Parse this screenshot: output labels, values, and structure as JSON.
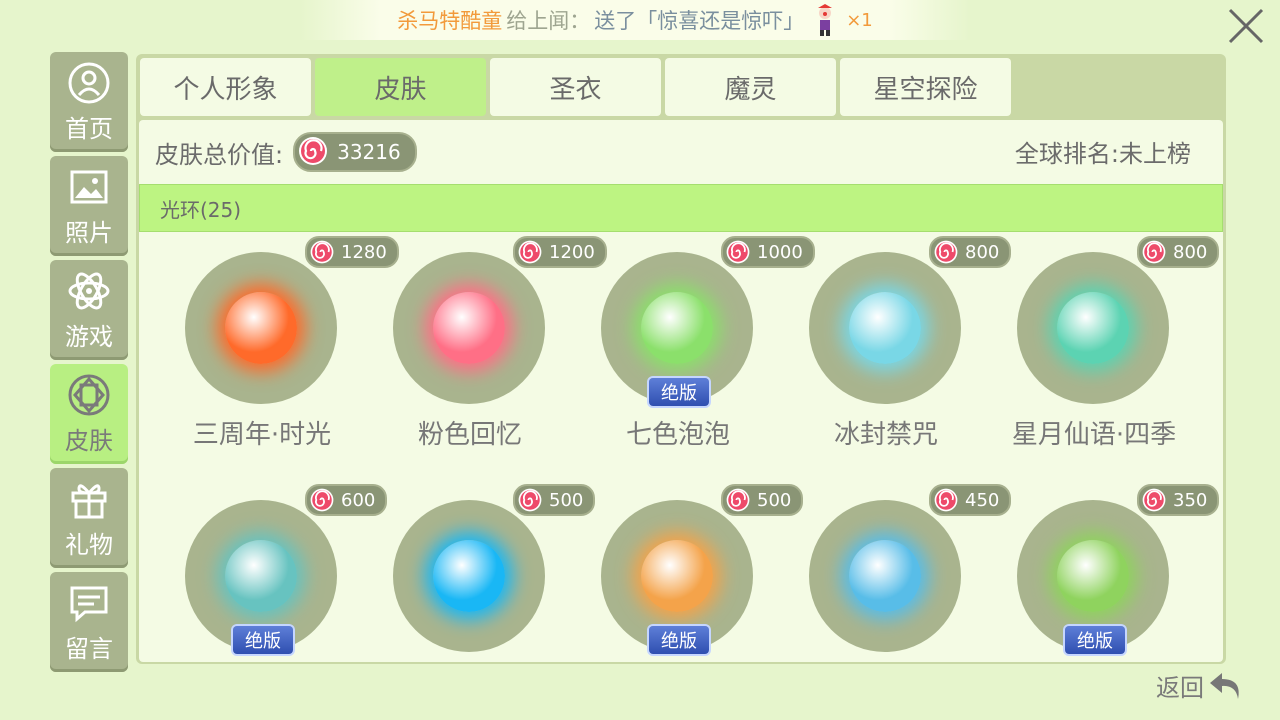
{
  "banner": {
    "sender": "杀马特酷童",
    "verb": "给上闻：",
    "gift_text": "送了「惊喜还是惊吓」",
    "count": "×1"
  },
  "sidebar": {
    "items": [
      {
        "label": "首页",
        "icon": "user-circle-icon"
      },
      {
        "label": "照片",
        "icon": "photo-icon"
      },
      {
        "label": "游戏",
        "icon": "atom-icon"
      },
      {
        "label": "皮肤",
        "icon": "gem-icon",
        "active": true
      },
      {
        "label": "礼物",
        "icon": "gift-icon"
      },
      {
        "label": "留言",
        "icon": "message-icon"
      }
    ]
  },
  "tabs": [
    {
      "label": "个人形象"
    },
    {
      "label": "皮肤",
      "active": true
    },
    {
      "label": "圣衣"
    },
    {
      "label": "魔灵"
    },
    {
      "label": "星空探险"
    }
  ],
  "summary": {
    "total_label": "皮肤总价值:",
    "total_value": "33216",
    "rank_text": "全球排名:未上榜"
  },
  "category": {
    "label": "光环(25)"
  },
  "items": [
    {
      "name": "三周年·时光",
      "price": "1280",
      "limited": false,
      "color": "#ff6a2a"
    },
    {
      "name": "粉色回忆",
      "price": "1200",
      "limited": false,
      "color": "#ff6f86"
    },
    {
      "name": "七色泡泡",
      "price": "1000",
      "limited": true,
      "color": "#8be06b"
    },
    {
      "name": "冰封禁咒",
      "price": "800",
      "limited": false,
      "color": "#79d7e6"
    },
    {
      "name": "星月仙语·四季",
      "price": "800",
      "limited": false,
      "color": "#5cd3b2"
    },
    {
      "name": "",
      "price": "600",
      "limited": true,
      "color": "#67c3c0"
    },
    {
      "name": "",
      "price": "500",
      "limited": false,
      "color": "#19b7f5"
    },
    {
      "name": "",
      "price": "500",
      "limited": true,
      "color": "#f4a34a"
    },
    {
      "name": "",
      "price": "450",
      "limited": false,
      "color": "#58bde8"
    },
    {
      "name": "",
      "price": "350",
      "limited": true,
      "color": "#8fd35e"
    }
  ],
  "limited_label": "绝版",
  "back_label": "返回"
}
